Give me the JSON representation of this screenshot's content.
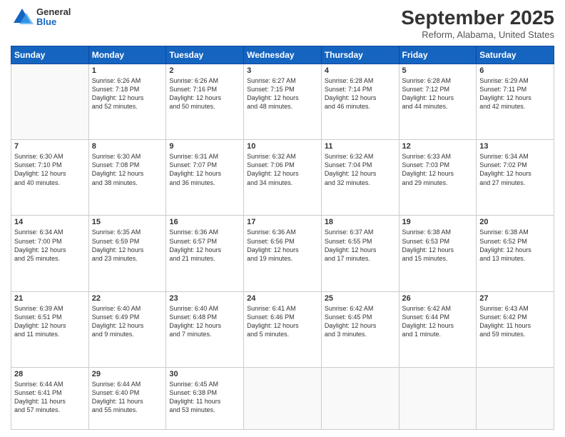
{
  "header": {
    "logo": {
      "general": "General",
      "blue": "Blue"
    },
    "month": "September 2025",
    "location": "Reform, Alabama, United States"
  },
  "weekdays": [
    "Sunday",
    "Monday",
    "Tuesday",
    "Wednesday",
    "Thursday",
    "Friday",
    "Saturday"
  ],
  "weeks": [
    [
      {
        "day": "",
        "info": ""
      },
      {
        "day": "1",
        "info": "Sunrise: 6:26 AM\nSunset: 7:18 PM\nDaylight: 12 hours\nand 52 minutes."
      },
      {
        "day": "2",
        "info": "Sunrise: 6:26 AM\nSunset: 7:16 PM\nDaylight: 12 hours\nand 50 minutes."
      },
      {
        "day": "3",
        "info": "Sunrise: 6:27 AM\nSunset: 7:15 PM\nDaylight: 12 hours\nand 48 minutes."
      },
      {
        "day": "4",
        "info": "Sunrise: 6:28 AM\nSunset: 7:14 PM\nDaylight: 12 hours\nand 46 minutes."
      },
      {
        "day": "5",
        "info": "Sunrise: 6:28 AM\nSunset: 7:12 PM\nDaylight: 12 hours\nand 44 minutes."
      },
      {
        "day": "6",
        "info": "Sunrise: 6:29 AM\nSunset: 7:11 PM\nDaylight: 12 hours\nand 42 minutes."
      }
    ],
    [
      {
        "day": "7",
        "info": "Sunrise: 6:30 AM\nSunset: 7:10 PM\nDaylight: 12 hours\nand 40 minutes."
      },
      {
        "day": "8",
        "info": "Sunrise: 6:30 AM\nSunset: 7:08 PM\nDaylight: 12 hours\nand 38 minutes."
      },
      {
        "day": "9",
        "info": "Sunrise: 6:31 AM\nSunset: 7:07 PM\nDaylight: 12 hours\nand 36 minutes."
      },
      {
        "day": "10",
        "info": "Sunrise: 6:32 AM\nSunset: 7:06 PM\nDaylight: 12 hours\nand 34 minutes."
      },
      {
        "day": "11",
        "info": "Sunrise: 6:32 AM\nSunset: 7:04 PM\nDaylight: 12 hours\nand 32 minutes."
      },
      {
        "day": "12",
        "info": "Sunrise: 6:33 AM\nSunset: 7:03 PM\nDaylight: 12 hours\nand 29 minutes."
      },
      {
        "day": "13",
        "info": "Sunrise: 6:34 AM\nSunset: 7:02 PM\nDaylight: 12 hours\nand 27 minutes."
      }
    ],
    [
      {
        "day": "14",
        "info": "Sunrise: 6:34 AM\nSunset: 7:00 PM\nDaylight: 12 hours\nand 25 minutes."
      },
      {
        "day": "15",
        "info": "Sunrise: 6:35 AM\nSunset: 6:59 PM\nDaylight: 12 hours\nand 23 minutes."
      },
      {
        "day": "16",
        "info": "Sunrise: 6:36 AM\nSunset: 6:57 PM\nDaylight: 12 hours\nand 21 minutes."
      },
      {
        "day": "17",
        "info": "Sunrise: 6:36 AM\nSunset: 6:56 PM\nDaylight: 12 hours\nand 19 minutes."
      },
      {
        "day": "18",
        "info": "Sunrise: 6:37 AM\nSunset: 6:55 PM\nDaylight: 12 hours\nand 17 minutes."
      },
      {
        "day": "19",
        "info": "Sunrise: 6:38 AM\nSunset: 6:53 PM\nDaylight: 12 hours\nand 15 minutes."
      },
      {
        "day": "20",
        "info": "Sunrise: 6:38 AM\nSunset: 6:52 PM\nDaylight: 12 hours\nand 13 minutes."
      }
    ],
    [
      {
        "day": "21",
        "info": "Sunrise: 6:39 AM\nSunset: 6:51 PM\nDaylight: 12 hours\nand 11 minutes."
      },
      {
        "day": "22",
        "info": "Sunrise: 6:40 AM\nSunset: 6:49 PM\nDaylight: 12 hours\nand 9 minutes."
      },
      {
        "day": "23",
        "info": "Sunrise: 6:40 AM\nSunset: 6:48 PM\nDaylight: 12 hours\nand 7 minutes."
      },
      {
        "day": "24",
        "info": "Sunrise: 6:41 AM\nSunset: 6:46 PM\nDaylight: 12 hours\nand 5 minutes."
      },
      {
        "day": "25",
        "info": "Sunrise: 6:42 AM\nSunset: 6:45 PM\nDaylight: 12 hours\nand 3 minutes."
      },
      {
        "day": "26",
        "info": "Sunrise: 6:42 AM\nSunset: 6:44 PM\nDaylight: 12 hours\nand 1 minute."
      },
      {
        "day": "27",
        "info": "Sunrise: 6:43 AM\nSunset: 6:42 PM\nDaylight: 11 hours\nand 59 minutes."
      }
    ],
    [
      {
        "day": "28",
        "info": "Sunrise: 6:44 AM\nSunset: 6:41 PM\nDaylight: 11 hours\nand 57 minutes."
      },
      {
        "day": "29",
        "info": "Sunrise: 6:44 AM\nSunset: 6:40 PM\nDaylight: 11 hours\nand 55 minutes."
      },
      {
        "day": "30",
        "info": "Sunrise: 6:45 AM\nSunset: 6:38 PM\nDaylight: 11 hours\nand 53 minutes."
      },
      {
        "day": "",
        "info": ""
      },
      {
        "day": "",
        "info": ""
      },
      {
        "day": "",
        "info": ""
      },
      {
        "day": "",
        "info": ""
      }
    ]
  ]
}
